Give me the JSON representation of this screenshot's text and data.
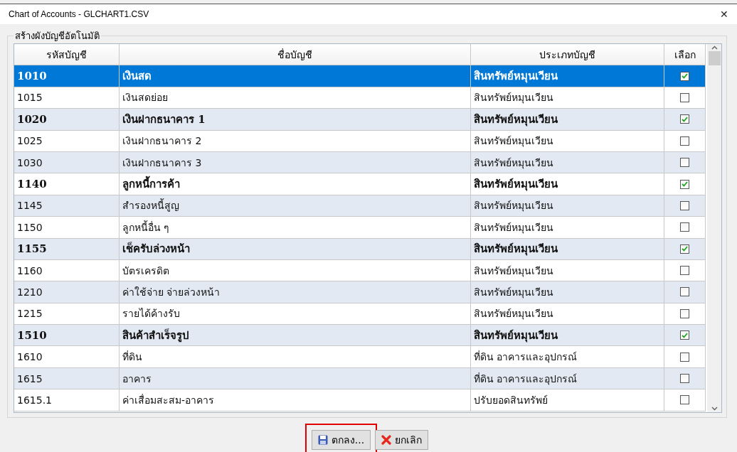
{
  "window": {
    "title": "Chart of Accounts - GLCHART1.CSV",
    "close": "✕"
  },
  "group": {
    "title": "สร้างผังบัญชีอัตโนมัติ"
  },
  "table": {
    "columns": [
      "รหัสบัญชี",
      "ชื่อบัญชี",
      "ประเภทบัญชี",
      "เลือก"
    ],
    "rows": [
      {
        "code": "1010",
        "name": "เงินสด",
        "type": "สินทรัพย์หมุนเวียน",
        "bold": true,
        "checked": true,
        "selected": true
      },
      {
        "code": "1015",
        "name": "เงินสดย่อย",
        "type": "สินทรัพย์หมุนเวียน",
        "bold": false,
        "checked": false,
        "selected": false
      },
      {
        "code": "1020",
        "name": "เงินฝากธนาคาร 1",
        "type": "สินทรัพย์หมุนเวียน",
        "bold": true,
        "checked": true,
        "selected": false
      },
      {
        "code": "1025",
        "name": "เงินฝากธนาคาร 2",
        "type": "สินทรัพย์หมุนเวียน",
        "bold": false,
        "checked": false,
        "selected": false
      },
      {
        "code": "1030",
        "name": "เงินฝากธนาคาร 3",
        "type": "สินทรัพย์หมุนเวียน",
        "bold": false,
        "checked": false,
        "selected": false
      },
      {
        "code": "1140",
        "name": "ลูกหนี้การค้า",
        "type": "สินทรัพย์หมุนเวียน",
        "bold": true,
        "checked": true,
        "selected": false
      },
      {
        "code": "1145",
        "name": "สำรองหนี้สูญ",
        "type": "สินทรัพย์หมุนเวียน",
        "bold": false,
        "checked": false,
        "selected": false
      },
      {
        "code": "1150",
        "name": "ลูกหนี้อื่น ๆ",
        "type": "สินทรัพย์หมุนเวียน",
        "bold": false,
        "checked": false,
        "selected": false
      },
      {
        "code": "1155",
        "name": "เช็ครับล่วงหน้า",
        "type": "สินทรัพย์หมุนเวียน",
        "bold": true,
        "checked": true,
        "selected": false
      },
      {
        "code": "1160",
        "name": "บัตรเครดิต",
        "type": "สินทรัพย์หมุนเวียน",
        "bold": false,
        "checked": false,
        "selected": false
      },
      {
        "code": "1210",
        "name": "ค่าใช้จ่าย จ่ายล่วงหน้า",
        "type": "สินทรัพย์หมุนเวียน",
        "bold": false,
        "checked": false,
        "selected": false
      },
      {
        "code": "1215",
        "name": "รายได้ค้างรับ",
        "type": "สินทรัพย์หมุนเวียน",
        "bold": false,
        "checked": false,
        "selected": false
      },
      {
        "code": "1510",
        "name": "สินค้าสำเร็จรูป",
        "type": "สินทรัพย์หมุนเวียน",
        "bold": true,
        "checked": true,
        "selected": false
      },
      {
        "code": "1610",
        "name": "ที่ดิน",
        "type": "ที่ดิน อาคารและอุปกรณ์",
        "bold": false,
        "checked": false,
        "selected": false
      },
      {
        "code": "1615",
        "name": "อาคาร",
        "type": "ที่ดิน อาคารและอุปกรณ์",
        "bold": false,
        "checked": false,
        "selected": false
      },
      {
        "code": "1615.1",
        "name": "ค่าเสื่อมสะสม-อาคาร",
        "type": "ปรับยอดสินทรัพย์",
        "bold": false,
        "checked": false,
        "selected": false
      }
    ]
  },
  "buttons": [
    {
      "kind": "save",
      "label": "ตกลง...",
      "highlighted": true
    },
    {
      "kind": "cancel",
      "label": "ยกเลิก",
      "highlighted": false
    }
  ]
}
